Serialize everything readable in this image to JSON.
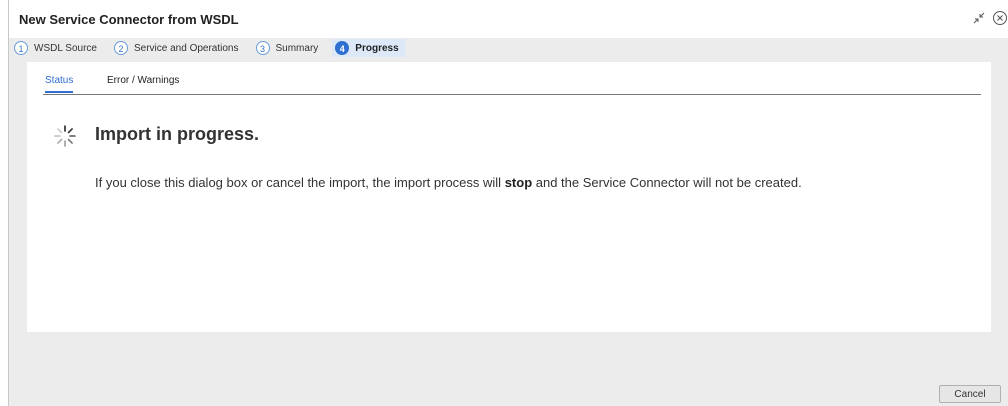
{
  "dialog": {
    "title": "New Service Connector from WSDL"
  },
  "window_icons": [
    "collapse-arrows-icon",
    "close-icon"
  ],
  "steps": [
    {
      "number": "1",
      "label": "WSDL Source",
      "active": false
    },
    {
      "number": "2",
      "label": "Service and Operations",
      "active": false
    },
    {
      "number": "3",
      "label": "Summary",
      "active": false
    },
    {
      "number": "4",
      "label": "Progress",
      "active": true
    }
  ],
  "tabs": [
    {
      "label": "Status",
      "active": true
    },
    {
      "label": "Error / Warnings",
      "active": false
    }
  ],
  "status": {
    "title": "Import in progress.",
    "message_before": "If you close this dialog box or cancel the import, the import process will ",
    "message_bold": "stop",
    "message_after": " and the Service Connector will not be created."
  },
  "footer": {
    "cancel_label": "Cancel"
  },
  "colors": {
    "accent": "#2f6fd0",
    "active_step_bg": "#dde9f8",
    "dialog_bg": "#ececec"
  }
}
